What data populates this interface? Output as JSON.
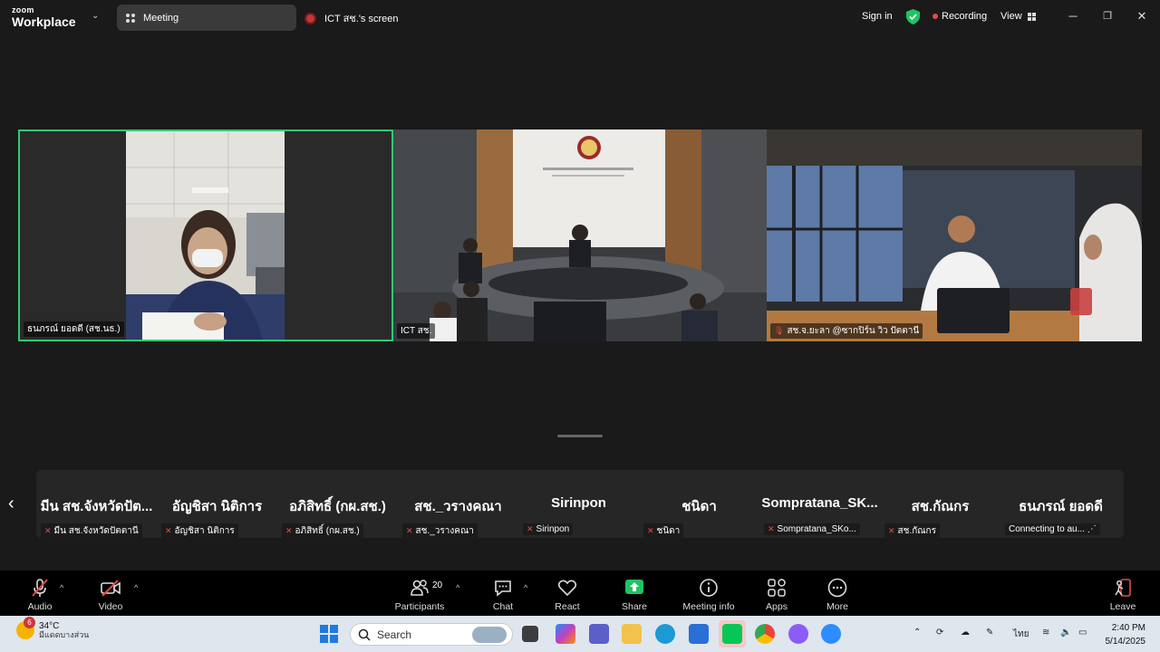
{
  "titlebar": {
    "brand_top": "zoom",
    "brand_bottom": "Workplace",
    "tab_meeting": "Meeting",
    "tab_screen": "ICT สช.'s screen",
    "sign_in": "Sign in",
    "recording": "Recording",
    "view": "View"
  },
  "videos": [
    {
      "name": "ธนภรณ์ ยอดดี (สช.นธ.)",
      "active": true
    },
    {
      "name": "ICT สช."
    },
    {
      "name": "สช.จ.ยะลา @ซากปิร์น วิว ปัตตานี"
    }
  ],
  "participants": [
    {
      "big": "มีน สช.จังหวัดปัต...",
      "small": "มีน สช.จังหวัดปัตตานี",
      "muted": true
    },
    {
      "big": "อัญชิสา นิติการ",
      "small": "อัญชิสา นิติการ",
      "muted": true
    },
    {
      "big": "อภิสิทธิ์ (กผ.สช.)",
      "small": "อภิสิทธิ์ (กผ.สช.)",
      "muted": true
    },
    {
      "big": "สช._วรางคณา",
      "small": "สช._วรางคณา",
      "muted": true
    },
    {
      "big": "Sirinpon",
      "small": "Sirinpon",
      "muted": true
    },
    {
      "big": "ชนิดา",
      "small": "ชนิดา",
      "muted": true
    },
    {
      "big": "Sompratana_SK...",
      "small": "Sompratana_SKo...",
      "muted": true
    },
    {
      "big": "สช.กัณกร",
      "small": "สช.กัณกร",
      "muted": true
    },
    {
      "big": "ธนภรณ์ ยอดดี",
      "small": "Connecting to au... ⋰",
      "muted": false
    }
  ],
  "toolbar": {
    "audio": "Audio",
    "video": "Video",
    "participants": "Participants",
    "participant_count": "20",
    "chat": "Chat",
    "react": "React",
    "share": "Share",
    "meeting_info": "Meeting info",
    "apps": "Apps",
    "more": "More",
    "leave": "Leave"
  },
  "taskbar": {
    "temp": "34°C",
    "weather_desc": "มีแดดบางส่วน",
    "weather_badge": "6",
    "search": "Search",
    "lang": "ไทย",
    "time": "2:40 PM",
    "date": "5/14/2025"
  },
  "colors": {
    "active_border": "#2ecc71",
    "share_green": "#1ec464",
    "rec_red": "#e24c4c"
  }
}
